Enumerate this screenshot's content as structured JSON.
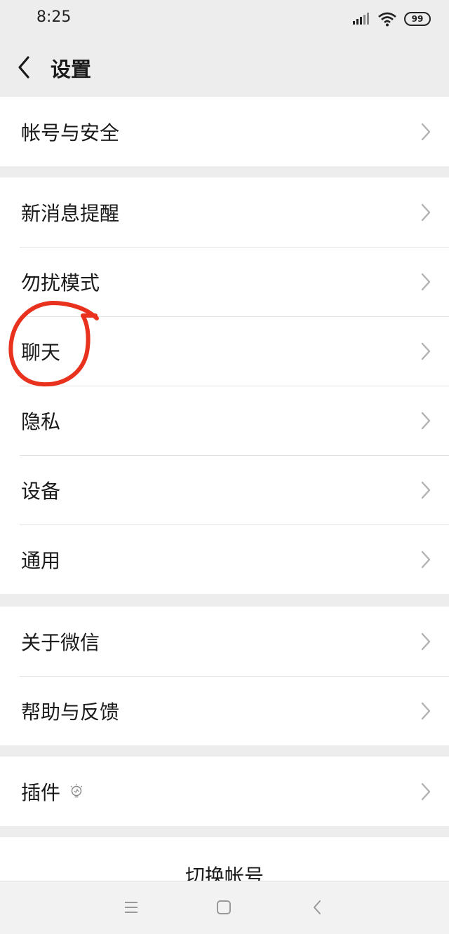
{
  "status_bar": {
    "time": "8:25",
    "battery": "99"
  },
  "nav": {
    "title": "设置"
  },
  "groups": {
    "g1": [
      {
        "label": "帐号与安全"
      }
    ],
    "g2": [
      {
        "label": "新消息提醒"
      },
      {
        "label": "勿扰模式"
      },
      {
        "label": "聊天"
      },
      {
        "label": "隐私"
      },
      {
        "label": "设备"
      },
      {
        "label": "通用"
      }
    ],
    "g3": [
      {
        "label": "关于微信"
      },
      {
        "label": "帮助与反馈"
      }
    ],
    "g4": [
      {
        "label": "插件"
      }
    ]
  },
  "switch_account": {
    "label": "切换帐号"
  },
  "colors": {
    "background": "#ededed",
    "annotation": "#e8321e"
  },
  "icons": [
    "back-icon",
    "chevron-right-icon",
    "bulb-icon",
    "menu-icon",
    "home-icon",
    "back-nav-icon",
    "signal-icon",
    "wifi-icon",
    "battery-icon"
  ]
}
